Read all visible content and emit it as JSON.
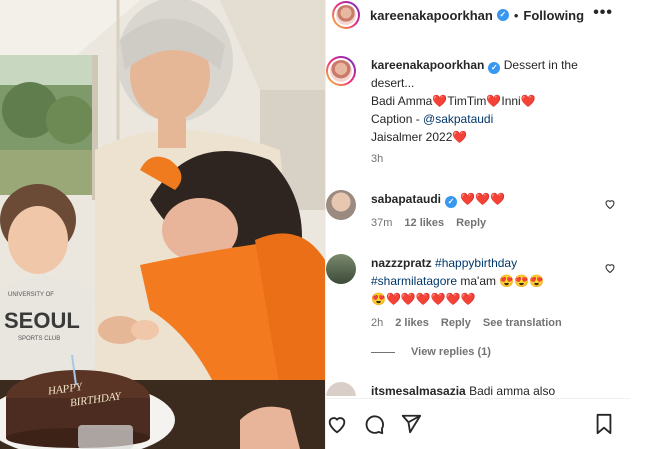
{
  "post": {
    "username": "kareenakapoorkhan",
    "separator": "•",
    "follow_status": "Following",
    "more_icon": "more-horizontal-icon"
  },
  "caption": {
    "username": "kareenakapoorkhan",
    "line1": "Dessert in the desert...",
    "line2_text": [
      "Badi Amma",
      "TimTim",
      "Inni"
    ],
    "credit_prefix": "Caption - ",
    "credit_tag": "@sakpataudi",
    "location_text": "Jaisalmer 2022",
    "time": "3h"
  },
  "comments": [
    {
      "username": "sabapataudi",
      "hearts": "❤️❤️❤️",
      "time": "37m",
      "likes": "12 likes",
      "reply": "Reply"
    },
    {
      "username": "nazzzpratz",
      "tag1": "#happybirthday",
      "tag2": "#sharmilatagore",
      "text": "ma'am",
      "time": "2h",
      "likes": "2 likes",
      "reply": "Reply",
      "translation": "See translation",
      "view_replies": "View replies (1)"
    },
    {
      "username": "itsmesalmasazia",
      "text": "Badi amma also"
    }
  ],
  "photo": {
    "cake_text_line1": "HAPPY",
    "cake_text_line2": "BIRTHDAY",
    "shirt_text": "SEOUL",
    "shirt_sub": "SPORTS CLUB",
    "shirt_top": "UNIVERSITY OF"
  },
  "colors": {
    "verified": "#3897f0",
    "heart": "#ed4956",
    "link": "#00376b",
    "muted": "#737373"
  }
}
